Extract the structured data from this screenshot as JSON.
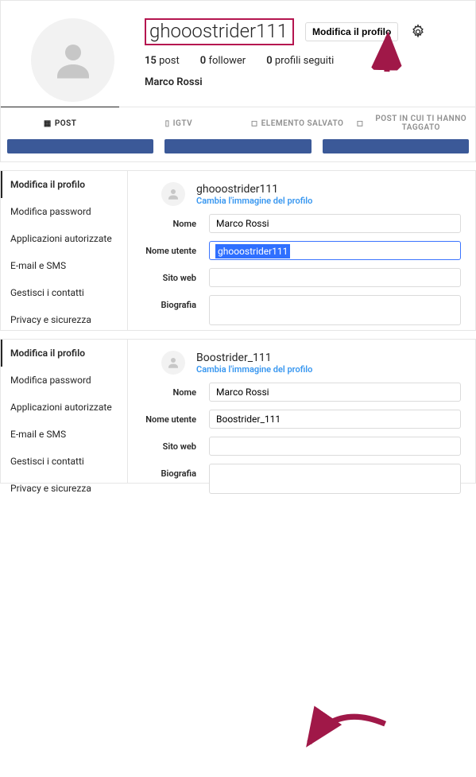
{
  "top": {
    "username": "ghooostrider111",
    "edit_btn": "Modifica il profilo",
    "stats": {
      "posts_n": "15",
      "posts_l": "post",
      "followers_n": "0",
      "followers_l": "follower",
      "following_n": "0",
      "following_l": "profili seguiti"
    },
    "fullname": "Marco Rossi"
  },
  "tabs": {
    "post": "POST",
    "igtv": "IGTV",
    "saved": "ELEMENTO SALVATO",
    "tagged": "POST IN CUI TI HANNO TAGGATO"
  },
  "side": {
    "edit_profile": "Modifica il profilo",
    "change_pw": "Modifica password",
    "apps": "Applicazioni autorizzate",
    "email_sms": "E-mail e SMS",
    "contacts": "Gestisci i contatti",
    "privacy": "Privacy e sicurezza"
  },
  "form_labels": {
    "name": "Nome",
    "username": "Nome utente",
    "website": "Sito web",
    "bio": "Biografia",
    "change_pic": "Cambia l'immagine del profilo"
  },
  "form1": {
    "title": "ghooostrider111",
    "name_value": "Marco Rossi",
    "username_value": "ghooostrider111"
  },
  "form2": {
    "title": "Boostrider_111",
    "name_value": "Marco Rossi",
    "username_value": "Boostrider_111"
  },
  "arrow_color": "#a01848"
}
